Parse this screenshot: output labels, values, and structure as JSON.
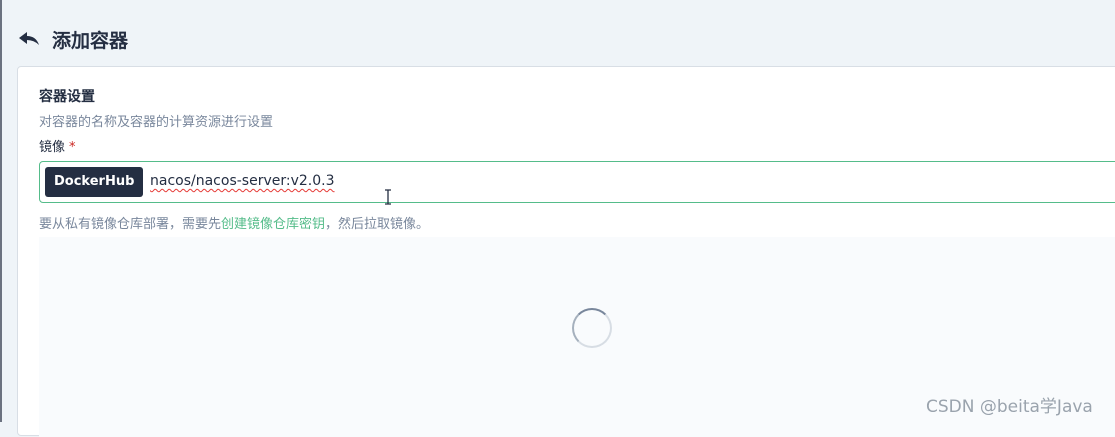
{
  "header": {
    "title": "添加容器",
    "back_icon": "back-arrow-icon"
  },
  "container_settings": {
    "title": "容器设置",
    "description": "对容器的名称及容器的计算资源进行设置",
    "image_label": "镜像",
    "required_mark": "*",
    "image_input": {
      "registry": "DockerHub",
      "value": "nacos/nacos-server:v2.0.3",
      "trailing_icon": "cube-icon"
    },
    "hint_prefix": "要从私有镜像仓库部署，需要先",
    "hint_link": "创建镜像仓库密钥",
    "hint_suffix": "，然后拉取镜像。",
    "loading_icon": "loading-spinner-icon"
  },
  "watermark": "CSDN @beita学Java",
  "colors": {
    "accent": "#55bc8a",
    "dark": "#242e42",
    "muted": "#79879c",
    "required": "#ca2621"
  }
}
